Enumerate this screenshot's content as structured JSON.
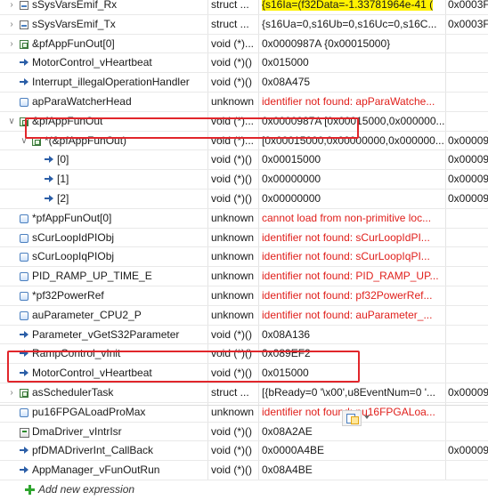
{
  "expressions": [
    {
      "name": "sSysVarsEmif_Rx",
      "type": "struct ...",
      "value": "{s16Ia=(f32Data=-1.33781964e-41 (",
      "loc": "0x0003F",
      "depth": 0,
      "twisty": "collapsed",
      "icon": "struct-icon",
      "value_style": "highlight"
    },
    {
      "name": "sSysVarsEmif_Tx",
      "type": "struct ...",
      "value": "{s16Ua=0,s16Ub=0,s16Uc=0,s16C...",
      "loc": "0x0003F",
      "depth": 0,
      "twisty": "collapsed",
      "icon": "struct-icon",
      "value_style": "normal"
    },
    {
      "name": "&pfAppFunOut[0]",
      "type": "void (*)...",
      "value": "0x0000987A {0x00015000}",
      "loc": "",
      "depth": 0,
      "twisty": "collapsed",
      "icon": "array-icon",
      "value_style": "normal"
    },
    {
      "name": "MotorControl_vHeartbeat",
      "type": "void (*)()",
      "value": "0x015000",
      "loc": "",
      "depth": 0,
      "twisty": "none",
      "icon": "pointer-icon",
      "value_style": "normal"
    },
    {
      "name": "Interrupt_illegalOperationHandler",
      "type": "void (*)()",
      "value": "0x08A475",
      "loc": "",
      "depth": 0,
      "twisty": "none",
      "icon": "pointer-icon",
      "value_style": "normal"
    },
    {
      "name": "apParaWatcherHead",
      "type": "unknown",
      "value": "identifier not found: apParaWatche...",
      "loc": "",
      "depth": 0,
      "twisty": "none",
      "icon": "variable-icon",
      "value_style": "error"
    },
    {
      "name": "&pfAppFunOut",
      "type": "void (*)...",
      "value": "0x0000987A [0x00015000,0x000000...",
      "loc": "",
      "depth": 0,
      "twisty": "expanded",
      "icon": "array-icon",
      "value_style": "normal"
    },
    {
      "name": "*(&pfAppFunOut)",
      "type": "void (*)...",
      "value": "[0x00015000,0x00000000,0x000000...",
      "loc": "0x00009",
      "depth": 1,
      "twisty": "expanded",
      "icon": "array-icon",
      "value_style": "normal"
    },
    {
      "name": "[0]",
      "type": "void (*)()",
      "value": "0x00015000",
      "loc": "0x00009",
      "depth": 2,
      "twisty": "none",
      "icon": "pointer-icon",
      "value_style": "normal"
    },
    {
      "name": "[1]",
      "type": "void (*)()",
      "value": "0x00000000",
      "loc": "0x00009",
      "depth": 2,
      "twisty": "none",
      "icon": "pointer-icon",
      "value_style": "normal"
    },
    {
      "name": "[2]",
      "type": "void (*)()",
      "value": "0x00000000",
      "loc": "0x00009",
      "depth": 2,
      "twisty": "none",
      "icon": "pointer-icon",
      "value_style": "normal"
    },
    {
      "name": "*pfAppFunOut[0]",
      "type": "unknown",
      "value": "cannot load from non-primitive loc...",
      "loc": "",
      "depth": 0,
      "twisty": "none",
      "icon": "variable-icon",
      "value_style": "error"
    },
    {
      "name": "sCurLoopIdPIObj",
      "type": "unknown",
      "value": "identifier not found: sCurLoopIdPI...",
      "loc": "",
      "depth": 0,
      "twisty": "none",
      "icon": "variable-icon",
      "value_style": "error"
    },
    {
      "name": "sCurLoopIqPIObj",
      "type": "unknown",
      "value": "identifier not found: sCurLoopIqPI...",
      "loc": "",
      "depth": 0,
      "twisty": "none",
      "icon": "variable-icon",
      "value_style": "error"
    },
    {
      "name": "PID_RAMP_UP_TIME_E",
      "type": "unknown",
      "value": "identifier not found: PID_RAMP_UP...",
      "loc": "",
      "depth": 0,
      "twisty": "none",
      "icon": "variable-icon",
      "value_style": "error"
    },
    {
      "name": "*pf32PowerRef",
      "type": "unknown",
      "value": "identifier not found: pf32PowerRef...",
      "loc": "",
      "depth": 0,
      "twisty": "none",
      "icon": "variable-icon",
      "value_style": "error"
    },
    {
      "name": "auParameter_CPU2_P",
      "type": "unknown",
      "value": "identifier not found: auParameter_...",
      "loc": "",
      "depth": 0,
      "twisty": "none",
      "icon": "variable-icon",
      "value_style": "error"
    },
    {
      "name": "Parameter_vGetS32Parameter",
      "type": "void (*)()",
      "value": "0x08A136",
      "loc": "",
      "depth": 0,
      "twisty": "none",
      "icon": "pointer-icon",
      "value_style": "normal"
    },
    {
      "name": "RampControl_vInit",
      "type": "void (*)()",
      "value": "0x089EF2",
      "loc": "",
      "depth": 0,
      "twisty": "none",
      "icon": "pointer-icon",
      "value_style": "normal"
    },
    {
      "name": "MotorControl_vHeartbeat",
      "type": "void (*)()",
      "value": "0x015000",
      "loc": "",
      "depth": 0,
      "twisty": "none",
      "icon": "pointer-icon",
      "value_style": "normal"
    },
    {
      "name": "asSchedulerTask",
      "type": "struct ...",
      "value": "[{bReady=0 '\\x00',u8EventNum=0 '...",
      "loc": "0x00009",
      "depth": 0,
      "twisty": "collapsed",
      "icon": "array-icon",
      "value_style": "normal"
    },
    {
      "name": "pu16FPGALoadProMax",
      "type": "unknown",
      "value": "identifier not found: pu16FPGALoa...",
      "loc": "",
      "depth": 0,
      "twisty": "none",
      "icon": "variable-icon",
      "value_style": "error"
    },
    {
      "name": "DmaDriver_vIntrIsr",
      "type": "void (*)()",
      "value": "0x08A2AE",
      "loc": "",
      "depth": 0,
      "twisty": "none",
      "icon": "function-icon",
      "value_style": "normal"
    },
    {
      "name": "pfDMADriverInt_CallBack",
      "type": "void (*)()",
      "value": "0x0000A4BE",
      "loc": "0x00009",
      "depth": 0,
      "twisty": "none",
      "icon": "pointer-icon",
      "value_style": "normal"
    },
    {
      "name": "AppManager_vFunOutRun",
      "type": "void (*)()",
      "value": "0x08A4BE",
      "loc": "",
      "depth": 0,
      "twisty": "none",
      "icon": "pointer-icon",
      "value_style": "normal"
    }
  ],
  "add_expression_label": "Add new expression",
  "colors": {
    "error_text": "#e0201c",
    "highlight": "#fff200",
    "annotation_box": "#e1262b"
  }
}
